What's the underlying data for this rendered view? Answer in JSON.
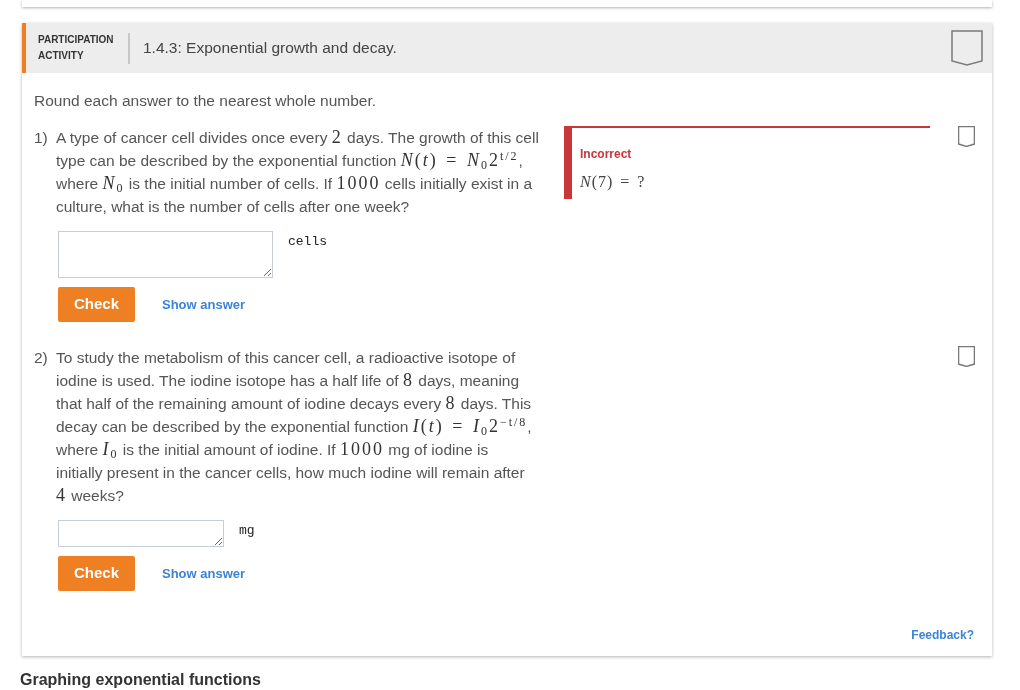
{
  "activity": {
    "label": "PARTICIPATION ACTIVITY",
    "title": "1.4.3: Exponential growth and decay.",
    "completed": false
  },
  "instructions": "Round each answer to the nearest whole number.",
  "questions": [
    {
      "number": "1)",
      "completed": false,
      "segments": [
        {
          "kind": "text",
          "text": "A type of cancer cell divides once every "
        },
        {
          "kind": "math",
          "text": "2"
        },
        {
          "kind": "text",
          "text": " days. The growth of this cell type can be described by the exponential function "
        },
        {
          "kind": "math",
          "text": "*N*(*t*) = *N*$_{0}$2$^{t/2}$"
        },
        {
          "kind": "text",
          "text": ", where "
        },
        {
          "kind": "math",
          "text": "*N*$_{0}$"
        },
        {
          "kind": "text",
          "text": " is the initial number of cells. If "
        },
        {
          "kind": "math",
          "text": "1000"
        },
        {
          "kind": "text",
          "text": " cells initially exist in a culture, what is the number of cells after one week?"
        }
      ],
      "answer": {
        "unit": "cells"
      },
      "check_label": "Check",
      "show_answer_label": "Show answer",
      "feedback": {
        "kind": "incorrect",
        "status": "Incorrect",
        "expression": "*N*(7) = ?"
      }
    },
    {
      "number": "2)",
      "completed": false,
      "segments": [
        {
          "kind": "text",
          "text": "To study the metabolism of this cancer cell, a radioactive isotope of iodine is used. The iodine isotope has a half life of "
        },
        {
          "kind": "math",
          "text": "8"
        },
        {
          "kind": "text",
          "text": " days, meaning that half of the remaining amount of iodine decays every "
        },
        {
          "kind": "math",
          "text": "8"
        },
        {
          "kind": "text",
          "text": " days. This decay can be described by the exponential function "
        },
        {
          "kind": "math",
          "text": "*I*(*t*) = *I*$_{0}$2$^{−t/8}$"
        },
        {
          "kind": "text",
          "text": ", where "
        },
        {
          "kind": "math",
          "text": "*I*$_{0}$"
        },
        {
          "kind": "text",
          "text": " is the initial amount of iodine. If "
        },
        {
          "kind": "math",
          "text": "1000"
        },
        {
          "kind": "text",
          "text": " mg of iodine is initially present in the cancer cells, how much iodine will remain after "
        },
        {
          "kind": "math",
          "text": "4"
        },
        {
          "kind": "text",
          "text": " weeks?"
        }
      ],
      "answer": {
        "unit": "mg"
      },
      "check_label": "Check",
      "show_answer_label": "Show answer"
    }
  ],
  "feedback_link": "Feedback?",
  "next_section": {
    "title": "Graphing exponential functions"
  }
}
